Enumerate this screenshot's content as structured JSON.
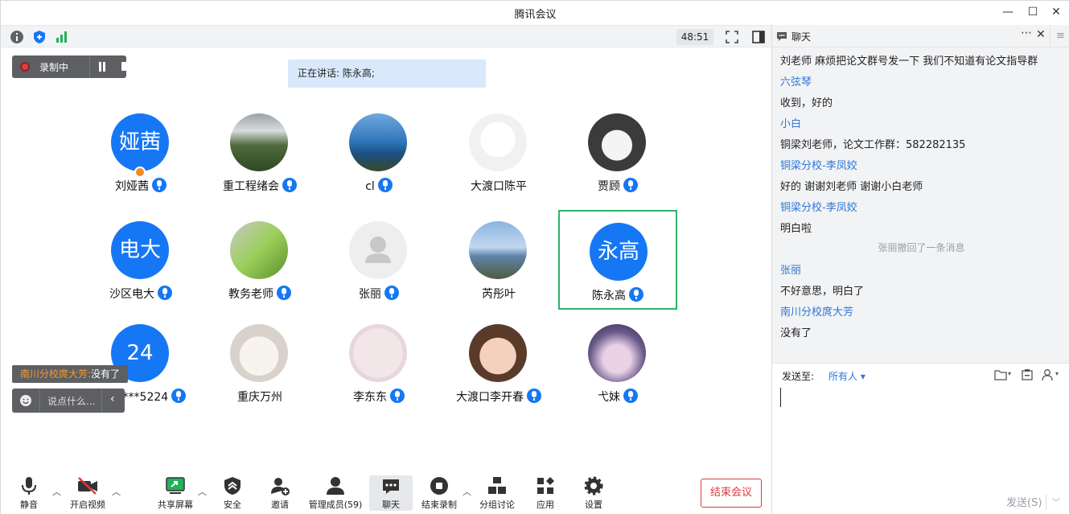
{
  "window": {
    "title": "腾讯会议"
  },
  "toolbar": {
    "timer": "48:51"
  },
  "recording": {
    "label": "录制中"
  },
  "speaking": {
    "text": "正在讲话: 陈永高;"
  },
  "participants": [
    {
      "name": "刘娅茜",
      "avatar_text": "娅茜",
      "avatar_color": "#1677f5",
      "mic": true,
      "host": true
    },
    {
      "name": "重工程绪会",
      "avatar_photo": "mountain",
      "mic": true
    },
    {
      "name": "cl",
      "avatar_photo": "lake",
      "mic": true
    },
    {
      "name": "大渡口陈平",
      "avatar_photo": "cartoon",
      "mic": false
    },
    {
      "name": "贾顾",
      "avatar_photo": "dog",
      "mic": true
    },
    {
      "name": "沙区电大",
      "avatar_text": "电大",
      "avatar_color": "#1677f5",
      "mic": true
    },
    {
      "name": "教务老师",
      "avatar_photo": "plant",
      "mic": true
    },
    {
      "name": "张丽",
      "avatar_photo": "default",
      "mic": true
    },
    {
      "name": "芮彤叶",
      "avatar_photo": "seaside",
      "mic": false
    },
    {
      "name": "陈永高",
      "avatar_text": "永高",
      "avatar_color": "#1677f5",
      "mic": true,
      "active": true
    },
    {
      "name": "135****5224",
      "avatar_text": "24",
      "avatar_color": "#1677f5",
      "mic": true
    },
    {
      "name": "重庆万州",
      "avatar_photo": "cat",
      "mic": false
    },
    {
      "name": "李东东",
      "avatar_photo": "family",
      "mic": true
    },
    {
      "name": "大渡口李开春",
      "avatar_photo": "cartoon-girl",
      "mic": true
    },
    {
      "name": "弋妹",
      "avatar_photo": "galaxy",
      "mic": true
    }
  ],
  "chat_popup": {
    "sender": "南川分校庹大芳:",
    "text": "没有了"
  },
  "say_box": {
    "placeholder": "说点什么..."
  },
  "bottom_toolbar": {
    "mute": "静音",
    "video": "开启视频",
    "share": "共享屏幕",
    "security": "安全",
    "invite": "邀请",
    "members": "管理成员(59)",
    "chat": "聊天",
    "stop_record": "结束录制",
    "breakout": "分组讨论",
    "apps": "应用",
    "settings": "设置",
    "end_meeting": "结束会议"
  },
  "chat_panel": {
    "title": "聊天",
    "messages": [
      {
        "kind": "text",
        "text": "刘老师 麻烦把论文群号发一下 我们不知道有论文指导群"
      },
      {
        "kind": "sender",
        "text": "六弦琴"
      },
      {
        "kind": "text",
        "text": "收到，好的"
      },
      {
        "kind": "sender",
        "text": "小白"
      },
      {
        "kind": "text",
        "text": "铜梁刘老师，论文工作群：582282135"
      },
      {
        "kind": "sender",
        "text": "铜梁分校-李凤姣"
      },
      {
        "kind": "text",
        "text": "好的 谢谢刘老师 谢谢小白老师"
      },
      {
        "kind": "sender",
        "text": "铜梁分校-李凤姣"
      },
      {
        "kind": "text",
        "text": "明白啦"
      },
      {
        "kind": "sys",
        "text": "张丽撤回了一条消息"
      },
      {
        "kind": "sender",
        "text": "张丽"
      },
      {
        "kind": "text",
        "text": "不好意思，明白了"
      },
      {
        "kind": "sender",
        "text": "南川分校庹大芳"
      },
      {
        "kind": "text",
        "text": "没有了"
      }
    ],
    "send_to_label": "发送至:",
    "send_to_value": "所有人",
    "send_button": "发送(S)"
  },
  "colors": {
    "accent": "#1677f5",
    "link": "#2d76d6",
    "danger": "#e0393a",
    "active_border": "#2fb26a"
  }
}
